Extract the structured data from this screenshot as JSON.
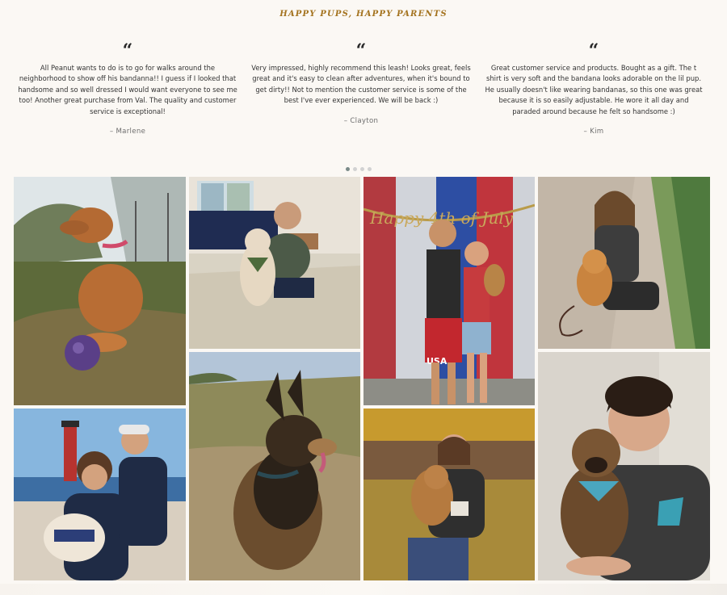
{
  "section": {
    "heading": "HAPPY PUPS, HAPPY PARENTS"
  },
  "quote_mark": "“",
  "testimonials": [
    {
      "text": "All Peanut wants to do is to go for walks around the neighborhood to show off his bandanna!! I guess if I looked that handsome and so well dressed I would want everyone to see me too! Another great purchase from Val. The quality and customer service is exceptional!",
      "author": "– Marlene"
    },
    {
      "text": "Very impressed, highly recommend this leash! Looks great, feels great and it's easy to clean after adventures, when it's bound to get dirty!! Not to mention the customer service is some of the best I've ever experienced. We will be back :)",
      "author": "– Clayton"
    },
    {
      "text": "Great customer service and products. Bought as a gift. The t shirt is very soft and the bandana looks adorable on the lil pup. He usually doesn't like wearing bandanas, so this one was great because it is so easily adjustable. He wore it all day and paraded around because he felt so handsome :)",
      "author": "– Kim"
    }
  ],
  "carousel": {
    "slide_count": 4,
    "active_index": 0
  },
  "gallery": {
    "photo_banner_text": "Happy 4th of July",
    "shirt_text": "USA"
  },
  "colors": {
    "heading_gold": "#a4731f",
    "page_bg": "#fbf8f4",
    "dot_active": "#7a8a88",
    "dot_inactive": "#d2d2d2"
  }
}
